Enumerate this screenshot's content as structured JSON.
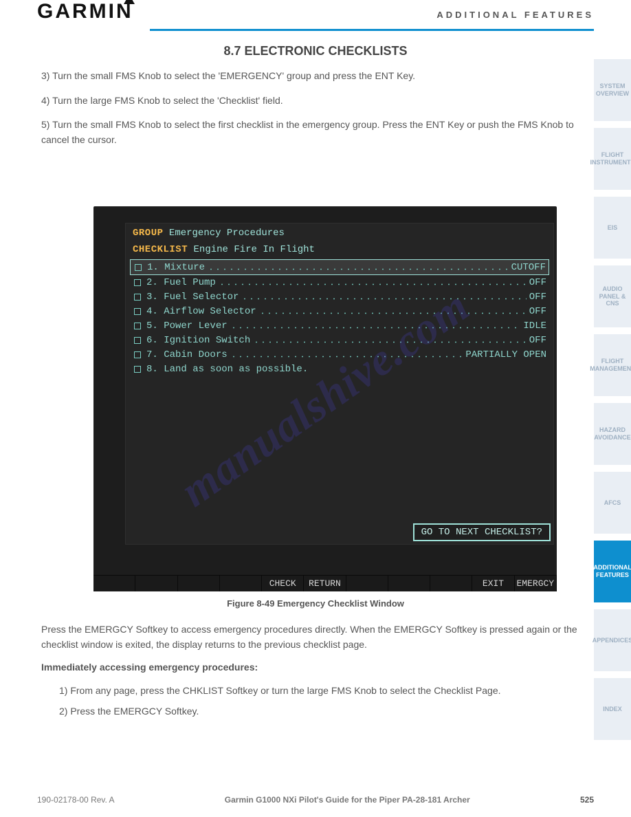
{
  "header": {
    "logo": "GARMIN",
    "title": "ADDITIONAL FEATURES"
  },
  "section_title": "8.7 ELECTRONIC CHECKLISTS",
  "intro1": "3)  Turn the small FMS Knob to select the 'EMERGENCY' group and press the ENT Key.",
  "intro2": "4)  Turn the large FMS Knob to select the 'Checklist' field.",
  "intro3": "5)  Turn the small FMS Knob to select the first checklist in the emergency group. Press the ENT Key or push the FMS Knob to cancel the cursor.",
  "shot": {
    "group_label": "GROUP",
    "group_value": "Emergency Procedures",
    "checklist_label": "CHECKLIST",
    "checklist_value": "Engine Fire In Flight",
    "items": [
      {
        "text": "1. Mixture",
        "val": "CUTOFF",
        "hl": true
      },
      {
        "text": "2. Fuel Pump",
        "val": "OFF"
      },
      {
        "text": "3. Fuel Selector",
        "val": "OFF"
      },
      {
        "text": "4. Airflow Selector",
        "val": "OFF"
      },
      {
        "text": "5. Power Lever",
        "val": "IDLE"
      },
      {
        "text": "6. Ignition Switch",
        "val": "OFF"
      },
      {
        "text": "7. Cabin Doors",
        "val": "PARTIALLY OPEN"
      },
      {
        "text": "8. Land as soon as possible.",
        "val": ""
      }
    ],
    "next_text": "GO TO NEXT CHECKLIST?",
    "softkeys": [
      "",
      "",
      "",
      "",
      "CHECK",
      "RETURN",
      "",
      "",
      "",
      "EXIT",
      "EMERGCY"
    ]
  },
  "caption": "Figure 8-49  Emergency Checklist Window",
  "para1": "Press the EMERGCY Softkey to access emergency procedures directly. When the EMERGCY Softkey is pressed again or the checklist window is exited, the display returns to the previous checklist page.",
  "heading_immediate": "Immediately accessing emergency procedures:",
  "step1": "1)  From any page, press the CHKLIST Softkey or turn the large FMS Knob to select the Checklist Page.",
  "step2": "2)  Press the EMERGCY Softkey.",
  "tabs": [
    "SYSTEM OVERVIEW",
    "FLIGHT INSTRUMENTS",
    "EIS",
    "AUDIO PANEL & CNS",
    "FLIGHT MANAGEMENT",
    "HAZARD AVOIDANCE",
    "AFCS",
    "ADDITIONAL FEATURES",
    "APPENDICES",
    "INDEX"
  ],
  "footer": {
    "left": "190-02178-00 Rev. A",
    "mid": "Garmin G1000 NXi Pilot's Guide for the Piper PA-28-181 Archer",
    "right": "525"
  },
  "watermark": "manualshive.com"
}
